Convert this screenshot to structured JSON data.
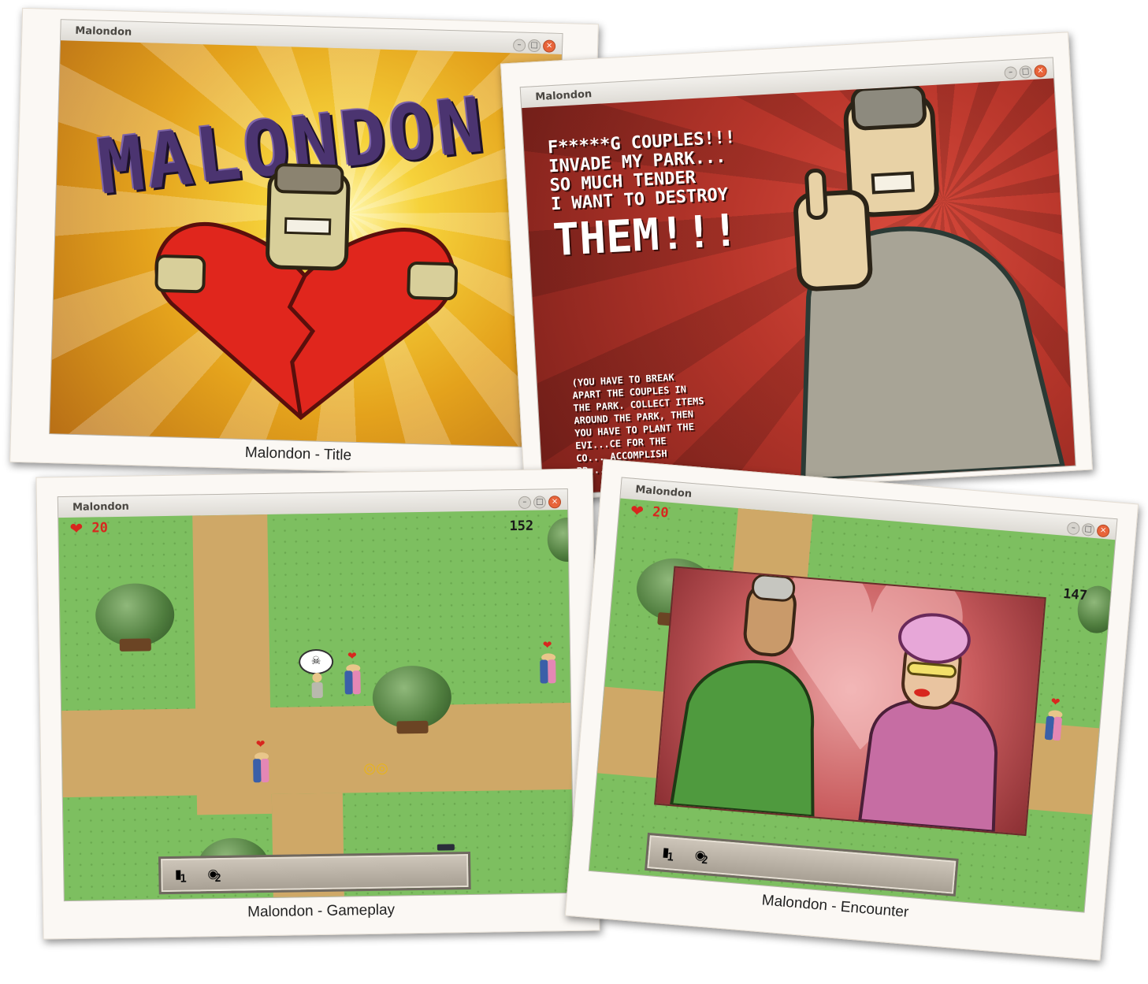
{
  "photos": {
    "title": {
      "window_title": "Malondon",
      "caption": "Malondon -  Title",
      "logo": "MALONDON"
    },
    "story": {
      "window_title": "Malondon",
      "lines": [
        "F*****G COUPLES!!!",
        "INVADE MY PARK...",
        "SO MUCH TENDER",
        "I WANT TO DESTROY"
      ],
      "shout": "THEM!!!",
      "instructions": [
        "(YOU HAVE TO BREAK",
        "APART THE COUPLES IN",
        "THE PARK. COLLECT ITEMS",
        "AROUND THE PARK, THEN",
        "YOU HAVE TO PLANT THE",
        "EVI...CE FOR THE",
        "CO... ACCOMPLISH",
        "BR..."
      ]
    },
    "gameplay": {
      "window_title": "Malondon",
      "caption": "Malondon - Gameplay",
      "lives": "20",
      "timer": "152",
      "inventory": [
        {
          "icon": "photo-item-icon",
          "count": "1"
        },
        {
          "icon": "sandwich-item-icon",
          "count": "2"
        }
      ]
    },
    "encounter": {
      "window_title": "Malondon",
      "caption": "Malondon - Encounter",
      "lives": "20",
      "timer": "147",
      "inventory": [
        {
          "icon": "photo-item-icon",
          "count": "1"
        },
        {
          "icon": "sandwich-item-icon",
          "count": "2"
        }
      ]
    }
  },
  "window_buttons": {
    "minimize": "–",
    "maximize": "□",
    "close": "×"
  },
  "colors": {
    "photo_frame": "#fbf8f4",
    "grass": "#7dbf60",
    "path": "#cfa867",
    "heart_red": "#d8261e",
    "close_button": "#e8643a"
  }
}
